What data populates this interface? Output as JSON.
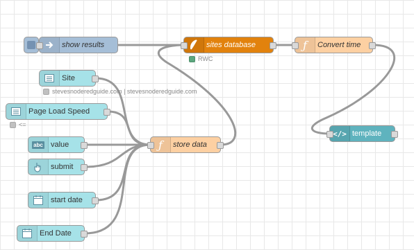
{
  "nodes": {
    "show_results": {
      "label": "show results",
      "icon": "arrow-right-icon"
    },
    "sites_database": {
      "label": "sites database",
      "icon": "feather-icon",
      "status": "RWC"
    },
    "convert_time": {
      "label": "Convert time",
      "icon": "function-icon"
    },
    "template": {
      "label": "template",
      "icon": "code-icon"
    },
    "site": {
      "label": "Site",
      "icon": "list-icon",
      "status": "stevesnoderedguide.com | stevesnoderedguide.com"
    },
    "page_load_speed": {
      "label": "Page Load Speed",
      "icon": "list-icon",
      "status": "<="
    },
    "value": {
      "label": "value",
      "icon": "abc-icon"
    },
    "submit": {
      "label": "submit",
      "icon": "hand-pointer-icon"
    },
    "store_data": {
      "label": "store data",
      "icon": "function-icon"
    },
    "start_date": {
      "label": "start date",
      "icon": "calendar-icon"
    },
    "end_date": {
      "label": "End Date",
      "icon": "calendar-icon"
    }
  },
  "colors": {
    "dashboard_input": "#a6e2e8",
    "debug": "#a5bed7",
    "sqlite": "#e2820d",
    "function": "#fdd0a2",
    "template": "#5fb3be",
    "wire": "#999999",
    "status_ok": "#5ba77e"
  }
}
